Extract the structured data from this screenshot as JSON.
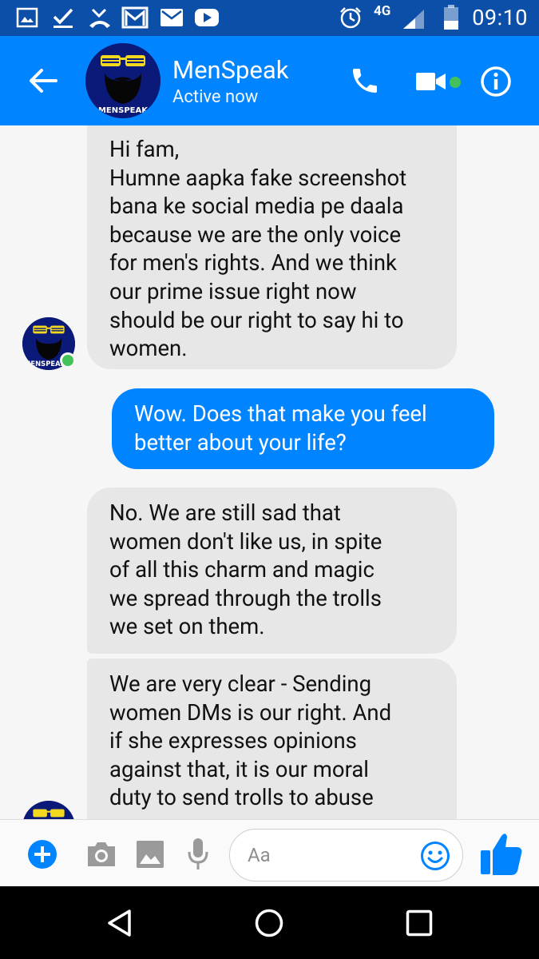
{
  "status_bar": {
    "time": "09:10",
    "network": "4G"
  },
  "header": {
    "title": "MenSpeak",
    "subtitle": "Active now",
    "avatar_text": "MENSPEAK",
    "icons": [
      "back-arrow-icon",
      "phone-icon",
      "video-camera-icon",
      "info-icon"
    ]
  },
  "conversation": {
    "messages": [
      {
        "direction": "incoming",
        "lines": [
          "Hi fam,",
          "Humne aapka fake screenshot",
          "bana ke social media pe daala",
          "because we are the only voice",
          "for men's rights. And we think",
          "our prime issue right now",
          "should be our right to say hi to",
          "women."
        ]
      },
      {
        "direction": "outgoing",
        "lines": [
          "Wow. Does that make you feel",
          "better about your life?"
        ]
      },
      {
        "direction": "incoming",
        "lines": [
          "No. We are still sad that",
          "women don't like us, in spite",
          "of all this charm and magic",
          "we spread through the trolls",
          "we set on them."
        ]
      },
      {
        "direction": "incoming",
        "lines": [
          "We are very clear - Sending",
          "women DMs is our right. And",
          "if she expresses opinions",
          "against that, it is our moral",
          "duty to send trolls to abuse"
        ]
      }
    ]
  },
  "compose": {
    "placeholder": "Aa",
    "icons": [
      "add-icon",
      "camera-icon",
      "gallery-icon",
      "microphone-icon",
      "emoji-icon",
      "thumbs-up-icon"
    ]
  },
  "colors": {
    "status_bar": "#0c4fa8",
    "app_bar": "#0084ff",
    "incoming_bubble": "#e7e7e7",
    "outgoing_bubble": "#0084ff",
    "online": "#44c25a"
  }
}
